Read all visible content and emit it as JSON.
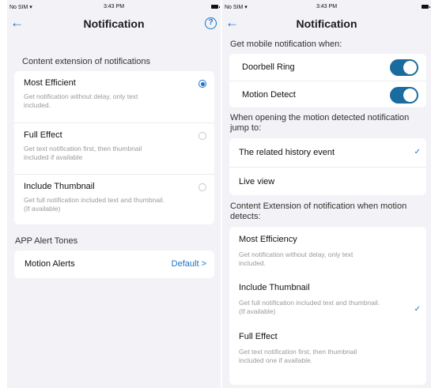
{
  "left": {
    "status": {
      "carrier": "No SIM",
      "time": "3:43 PM"
    },
    "nav": {
      "back_icon": "←",
      "title": "Notification",
      "help_icon": "?"
    },
    "section_content_extension": "Content extension of notifications",
    "options": [
      {
        "name": "Most Efficient",
        "desc": "Get notification without delay, only text included.",
        "selected": true
      },
      {
        "name": "Full Effect",
        "desc": "Get text notification first, then thumbnail included if available",
        "selected": false
      },
      {
        "name": "Include Thumbnail",
        "desc": "Get full notification included text and thumbnail. (If available)",
        "selected": false
      }
    ],
    "section_alert_tones": "APP Alert Tones",
    "motion_alerts": {
      "name": "Motion Alerts",
      "value": "Default >"
    }
  },
  "right": {
    "status": {
      "carrier": "No SIM",
      "time": "3:43 PM"
    },
    "nav": {
      "back_icon": "←",
      "title": "Notification"
    },
    "section_get_mobile": "Get mobile notification when:",
    "toggles": [
      {
        "name": "Doorbell Ring",
        "on": true
      },
      {
        "name": "Motion Detect",
        "on": true
      }
    ],
    "section_jump_to": "When opening the motion detected notification jump to:",
    "jump_options": [
      {
        "name": "The related history event",
        "checked": true
      },
      {
        "name": "Live view",
        "checked": false
      }
    ],
    "section_content_extension": "Content Extension of notification when motion detects:",
    "ext_options": [
      {
        "name": "Most Efficiency",
        "desc": "Get notification without delay, only text included.",
        "checked": false
      },
      {
        "name": "Include Thumbnail",
        "desc": "Get full notification included text and thumbnail. (If available)",
        "checked": true
      },
      {
        "name": "Full Effect",
        "desc": "Get text notification first, then thumbnail included one if available.",
        "checked": false
      }
    ]
  },
  "colors": {
    "accent": "#1a73c9",
    "toggle_on": "#1a6c9e",
    "background": "#f2f2f7"
  },
  "icons": {
    "back": "back-arrow-icon",
    "help": "help-icon",
    "check": "checkmark-icon",
    "wifi": "wifi-icon",
    "battery": "battery-icon"
  }
}
